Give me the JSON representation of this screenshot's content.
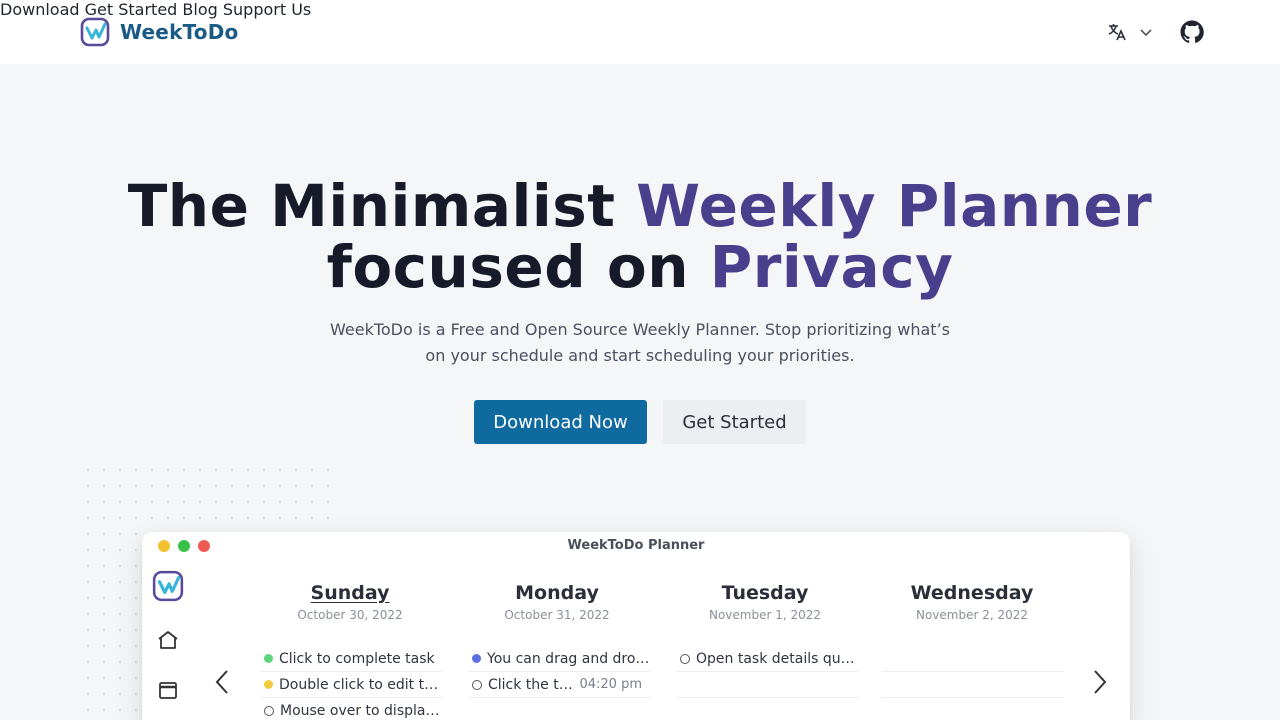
{
  "header": {
    "brand": "WeekToDo",
    "nav": [
      {
        "label": "Download"
      },
      {
        "label": "Get Started"
      },
      {
        "label": "Blog"
      },
      {
        "label": "Support Us"
      }
    ],
    "language_icon": "translate-icon",
    "github_icon": "github-icon"
  },
  "hero": {
    "title_part1": "The Minimalist ",
    "title_accent1": "Weekly Planner",
    "title_part2": "focused on ",
    "title_accent2": "Privacy",
    "subtitle": "WeekToDo is a Free and Open Source Weekly Planner. Stop prioritizing what’s on your schedule and start scheduling your priorities.",
    "primary_button": "Download Now",
    "secondary_button": "Get Started"
  },
  "app": {
    "window_title": "WeekToDo Planner",
    "days": [
      {
        "name": "Sunday",
        "date": "October 30, 2022",
        "today": true,
        "tasks": [
          {
            "text": "Click to complete task",
            "marker": "dot",
            "color": "#5cd67a"
          },
          {
            "text": "Double click to edit task",
            "marker": "dot",
            "color": "#f2cc3b"
          },
          {
            "text": "Mouse over to display…",
            "marker": "ring",
            "color": "#555555"
          }
        ]
      },
      {
        "name": "Monday",
        "date": "October 31, 2022",
        "today": false,
        "tasks": [
          {
            "text": "You can drag and dro…",
            "marker": "dot",
            "color": "#5a6ee0"
          },
          {
            "text": "Click the thr…",
            "marker": "ring",
            "color": "#555555",
            "time": "04:20 pm"
          }
        ]
      },
      {
        "name": "Tuesday",
        "date": "November 1, 2022",
        "today": false,
        "tasks": [
          {
            "text": "Open task details quic…",
            "marker": "ring",
            "color": "#555555"
          }
        ]
      },
      {
        "name": "Wednesday",
        "date": "November 2, 2022",
        "today": false,
        "tasks": []
      }
    ]
  },
  "colors": {
    "brand": "#1a5b86",
    "accent": "#4a3f8c",
    "primary_button": "#0f6aa0"
  }
}
